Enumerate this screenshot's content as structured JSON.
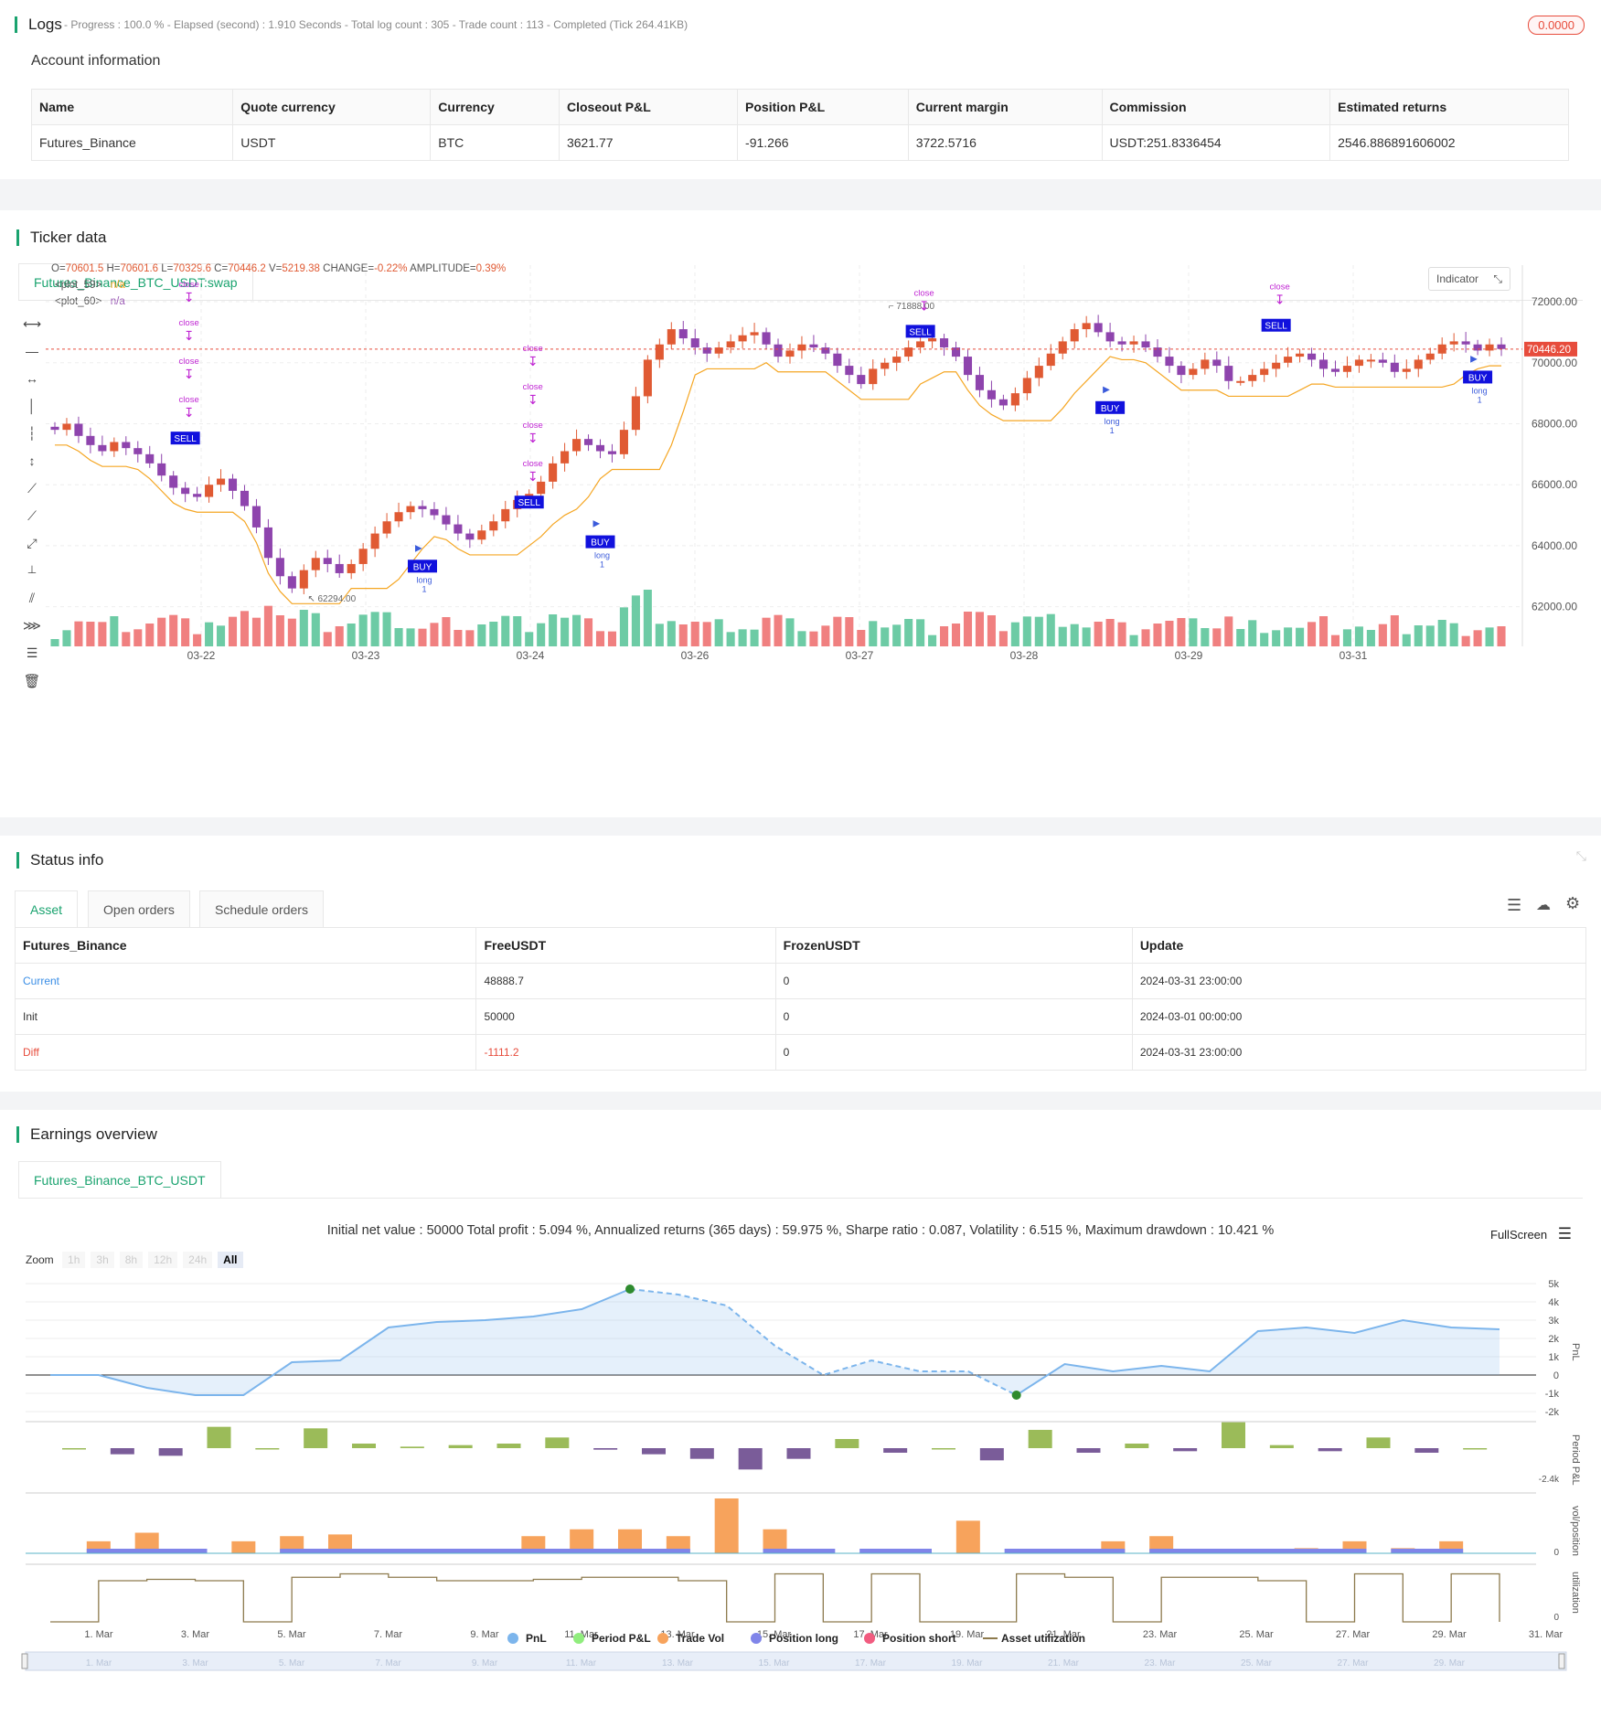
{
  "logs": {
    "title": "Logs",
    "summary": "- Progress : 100.0 % - Elapsed (second) : 1.910  Seconds - Total log count : 305 - Trade count : 113 - Completed (Tick 264.41KB)",
    "badge": "0.0000"
  },
  "account": {
    "title": "Account information",
    "headers": [
      "Name",
      "Quote currency",
      "Currency",
      "Closeout P&L",
      "Position P&L",
      "Current margin",
      "Commission",
      "Estimated returns"
    ],
    "row": [
      "Futures_Binance",
      "USDT",
      "BTC",
      "3621.77",
      "-91.266",
      "3722.5716",
      "USDT:251.8336454",
      "2546.886891606002"
    ]
  },
  "ticker": {
    "title": "Ticker data",
    "tab": "Futures_Binance_BTC_USDT:swap",
    "ohlc": {
      "o_label": "O=",
      "o": "70601.5",
      "h_label": "H=",
      "h": "70601.6",
      "l_label": "L=",
      "l": "70329.6",
      "c_label": "C=",
      "c": "70446.2",
      "v_label": "V=",
      "v": "5219.38",
      "change_label": "CHANGE=",
      "change": "-0.22%",
      "amp_label": "AMPLITUDE=",
      "amp": "0.39%"
    },
    "plots": [
      {
        "name": "<plot_59>",
        "value": "n/a",
        "color": "#f5a623"
      },
      {
        "name": "<plot_60>",
        "value": "n/a",
        "color": "#9b59b6"
      }
    ],
    "indicator_button": "Indicator",
    "price_tag": "70446.20",
    "high_marker": "71888.00",
    "low_marker": "62294.00"
  },
  "chart_data": {
    "type": "candlestick",
    "x_ticks": [
      "03-22",
      "03-23",
      "03-24",
      "03-26",
      "03-27",
      "03-28",
      "03-29",
      "03-31"
    ],
    "y_ticks": [
      "72000.00",
      "70000.00",
      "68000.00",
      "66000.00",
      "64000.00",
      "62000.00"
    ],
    "ylim": [
      61300,
      73200
    ],
    "last_price": 70446.2,
    "high": 71888.0,
    "low": 62294.0,
    "closes": [
      67800,
      68000,
      67600,
      67300,
      67100,
      67400,
      67200,
      67000,
      66700,
      66300,
      65900,
      65700,
      65600,
      66000,
      66200,
      65800,
      65300,
      64600,
      63600,
      63000,
      62600,
      63200,
      63600,
      63400,
      63100,
      63400,
      63900,
      64400,
      64800,
      65100,
      65300,
      65200,
      65000,
      64700,
      64400,
      64200,
      64500,
      64800,
      65200,
      65500,
      65700,
      66100,
      66700,
      67100,
      67500,
      67300,
      67100,
      67000,
      67800,
      68900,
      70100,
      70600,
      71100,
      70800,
      70500,
      70300,
      70500,
      70700,
      70900,
      71000,
      70600,
      70200,
      70400,
      70600,
      70500,
      70300,
      69900,
      69600,
      69300,
      69800,
      70000,
      70200,
      70500,
      70700,
      70800,
      70500,
      70200,
      69600,
      69100,
      68800,
      68600,
      69000,
      69500,
      69900,
      70300,
      70700,
      71100,
      71300,
      71000,
      70700,
      70600,
      70700,
      70500,
      70200,
      69900,
      69600,
      69800,
      70100,
      69900,
      69400,
      69400,
      69600,
      69800,
      70000,
      70200,
      70300,
      70100,
      69800,
      69700,
      69900,
      70100,
      70100,
      70000,
      69700,
      69800,
      70100,
      70300,
      70600,
      70700,
      70600,
      70400,
      70600,
      70450
    ],
    "x_labels_candles_per_tick": 15,
    "trail_line_color": "#f5a623",
    "up_color": "#e05a33",
    "down_color": "#8e44ad",
    "volume_up": "#6dcba5",
    "volume_down": "#f08080",
    "signals": [
      {
        "label": "SELL",
        "idx": 11,
        "price": 67500
      },
      {
        "label": "BUY",
        "idx": 31,
        "price": 63300
      },
      {
        "label": "SELL",
        "idx": 40,
        "price": 65400
      },
      {
        "label": "BUY",
        "idx": 46,
        "price": 64100
      },
      {
        "label": "SELL",
        "idx": 73,
        "price": 71000
      },
      {
        "label": "BUY",
        "idx": 89,
        "price": 68500
      },
      {
        "label": "SELL",
        "idx": 103,
        "price": 71200
      },
      {
        "label": "BUY",
        "idx": 120,
        "price": 69500
      }
    ],
    "close_label": "close",
    "long_label": "long",
    "all_label": "Al",
    "one_label": "1"
  },
  "status": {
    "title": "Status info",
    "tabs": [
      "Asset",
      "Open orders",
      "Schedule orders"
    ],
    "headers": [
      "Futures_Binance",
      "FreeUSDT",
      "FrozenUSDT",
      "Update"
    ],
    "rows": [
      [
        "Current",
        "48888.7",
        "0",
        "2024-03-31 23:00:00"
      ],
      [
        "Init",
        "50000",
        "0",
        "2024-03-01 00:00:00"
      ],
      [
        "Diff",
        "-1111.2",
        "0",
        "2024-03-31 23:00:00"
      ]
    ]
  },
  "earnings": {
    "title": "Earnings overview",
    "tab": "Futures_Binance_BTC_USDT",
    "summary": "Initial net value : 50000 Total profit : 5.094 %, Annualized returns (365 days) : 59.975 %, Sharpe ratio : 0.087, Volatility : 6.515 %, Maximum drawdown : 10.421 %",
    "fullscreen": "FullScreen",
    "zoom_label": "Zoom",
    "zoom_options": [
      "1h",
      "3h",
      "8h",
      "12h",
      "24h",
      "All"
    ],
    "pnl_ticks": [
      "5k",
      "4k",
      "3k",
      "2k",
      "1k",
      "0",
      "-1k",
      "-2k"
    ],
    "axis_titles": [
      "PnL",
      "Period P&L",
      "vol/position",
      "utilization"
    ],
    "period_min_label": "-2.4k",
    "vol_zero": "0",
    "util_zero": "0",
    "x_ticks": [
      "1. Mar",
      "3. Mar",
      "5. Mar",
      "7. Mar",
      "9. Mar",
      "11. Mar",
      "13. Mar",
      "15. Mar",
      "17. Mar",
      "19. Mar",
      "21. Mar",
      "23. Mar",
      "25. Mar",
      "27. Mar",
      "29. Mar",
      "31. Mar"
    ],
    "legend": [
      {
        "label": "PnL",
        "color": "#7cb5ec"
      },
      {
        "label": "Period P&L",
        "color": "#90ed7d"
      },
      {
        "label": "Trade Vol",
        "color": "#f7a35c"
      },
      {
        "label": "Position long",
        "color": "#8085e9"
      },
      {
        "label": "Position short",
        "color": "#f15c80"
      },
      {
        "label": "Asset utilization",
        "color": "#8d7a4d"
      }
    ],
    "pnl_series": [
      0,
      0,
      -700,
      -1100,
      -1100,
      700,
      800,
      2600,
      2900,
      3000,
      3200,
      3600,
      4700,
      4400,
      3800,
      1600,
      0,
      800,
      200,
      200,
      -1100,
      600,
      200,
      500,
      200,
      2400,
      2600,
      2300,
      3000,
      2600,
      2500
    ],
    "period_series": [
      0,
      -400,
      -500,
      1400,
      0,
      1300,
      300,
      100,
      200,
      300,
      700,
      -100,
      -400,
      -700,
      -1400,
      -700,
      600,
      -300,
      0,
      -800,
      1200,
      -300,
      300,
      -200,
      1700,
      200,
      -200,
      700,
      -300,
      0
    ],
    "vol_series": [
      0,
      700,
      1200,
      0,
      700,
      1000,
      1100,
      0,
      0,
      0,
      1000,
      1400,
      1400,
      1000,
      3200,
      1400,
      0,
      0,
      0,
      1900,
      0,
      0,
      700,
      1000,
      0,
      0,
      300,
      700,
      300,
      700,
      0
    ],
    "util_series": [
      0,
      0.6,
      0.62,
      0.6,
      0,
      0.65,
      0.7,
      0.65,
      0.6,
      0.6,
      0.62,
      0.65,
      0.65,
      0.6,
      0,
      0.7,
      0,
      0.7,
      0,
      0,
      0.7,
      0.65,
      0,
      0.65,
      0.65,
      0.6,
      0,
      0.7,
      0,
      0.7,
      0
    ],
    "navigator_ticks": [
      "1. Mar",
      "3. Mar",
      "5. Mar",
      "7. Mar",
      "9. Mar",
      "11. Mar",
      "13. Mar",
      "15. Mar",
      "17. Mar",
      "19. Mar",
      "21. Mar",
      "23. Mar",
      "25. Mar",
      "27. Mar",
      "29. Mar"
    ]
  }
}
